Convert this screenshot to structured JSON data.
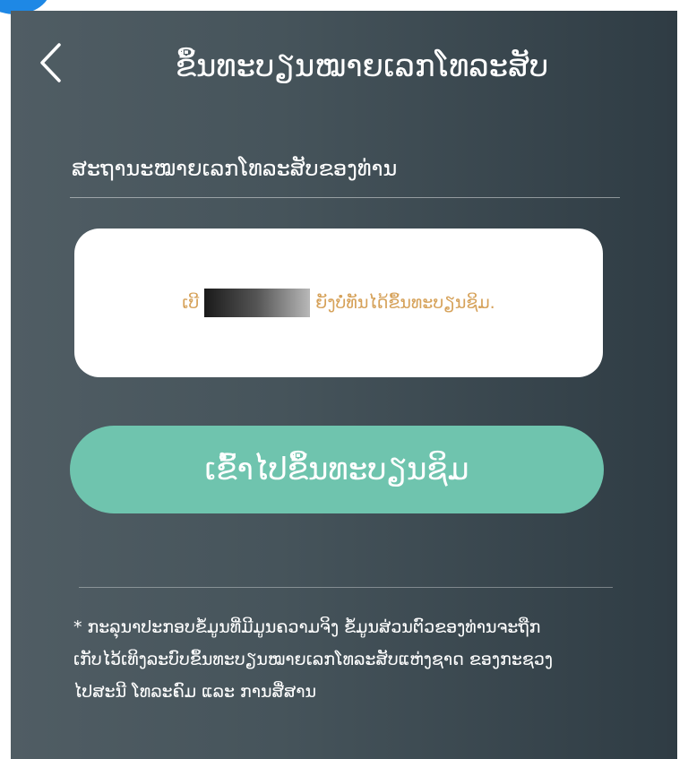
{
  "header": {
    "back_icon": "chevron-left-icon",
    "title": "ຂຶ້ນທະບຽນໝາຍເລກໂທລະສັບ"
  },
  "form": {
    "status_label": "ສະຖານະໝາຍເລກໂທລະສັບຂອງທ່ານ"
  },
  "status_card": {
    "prefix": "ເບີ",
    "message": "ຍັງບໍ່ທັນໄດ້ຂຶ້ນທະບຽນຊິມ."
  },
  "actions": {
    "register_label": "ເຂົ້າໄປຂຶ້ນທະບຽນຊິມ"
  },
  "notice": {
    "line1": "* ກະລຸນາປະກອບຂໍ້ມູນທີ່ມີມູນຄວາມຈິງ   ຂໍ້ມູນສ່ວນຕົວຂອງທ່ານຈະຖືກ",
    "line2": "ເກັບໄວ້ເທິງລະບົບຂຶ້ນທະບຽນໝາຍເລກໂທລະສັບແຫ່ງຊາດ   ຂອງກະຊວງ",
    "line3": "ໄປສະນີ ໂທລະຄົມ ແລະ ການສື່ສານ"
  },
  "colors": {
    "background_start": "#505d64",
    "background_end": "#2f3c44",
    "button": "#6fc4ae",
    "status_text": "#d6a25a"
  }
}
